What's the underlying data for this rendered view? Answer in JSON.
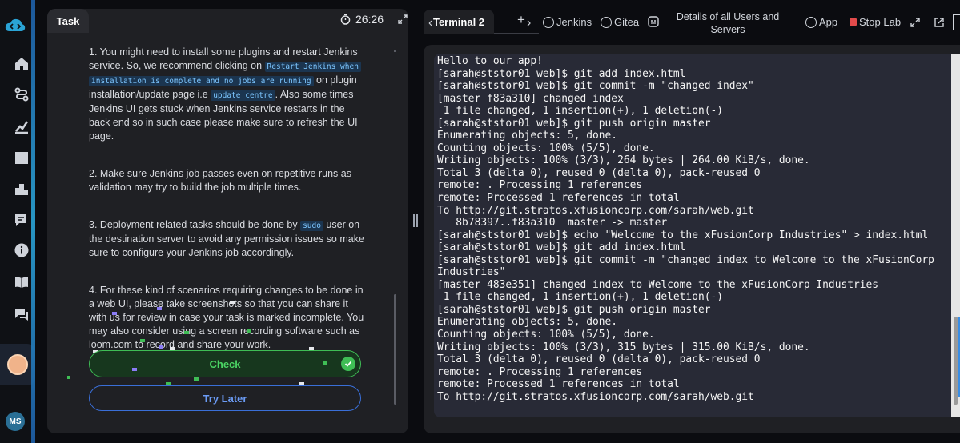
{
  "task": {
    "tab_label": "Task",
    "timer": "26:26",
    "paragraphs": [
      {
        "t1": "1. You might need to install some plugins and restart Jenkins service. So, we recommend clicking on ",
        "c1": "Restart Jenkins when",
        "c1b": "installation is complete and no jobs are running",
        "t2": " on plugin installation/update page i.e ",
        "c2": "update centre",
        "t3": ". Also some times Jenkins UI gets stuck when Jenkins service restarts in the back end so in such case please make sure to refresh the UI page."
      },
      {
        "t1": "2. Make sure Jenkins job passes even on repetitive runs as validation may try to build the job multiple times."
      },
      {
        "t1": "3. Deployment related tasks should be done by ",
        "c1": "sudo",
        "t2": " user on the destination server to avoid any permission issues so make sure to configure your Jenkins job accordingly."
      },
      {
        "t1": "4. For these kind of scenarios requiring changes to be done in a web UI, please take screenshots so that you can share it with us for review in case your task is marked incomplete. You may also consider using a screen recording software such as loom.com to record and share your work."
      }
    ],
    "check_label": "Check",
    "later_label": "Try Later"
  },
  "topbar": {
    "terminal_tab": "Terminal 2",
    "links": {
      "jenkins": "Jenkins",
      "gitea": "Gitea",
      "details": "Details of all Users and Servers",
      "app": "App",
      "stop": "Stop Lab"
    }
  },
  "user": {
    "initials": "MS"
  },
  "terminal": {
    "lines": [
      "Hello to our app!",
      "[sarah@ststor01 web]$ git add index.html",
      "[sarah@ststor01 web]$ git commit -m \"changed index\"",
      "[master f83a310] changed index",
      " 1 file changed, 1 insertion(+), 1 deletion(-)",
      "[sarah@ststor01 web]$ git push origin master",
      "Enumerating objects: 5, done.",
      "Counting objects: 100% (5/5), done.",
      "Writing objects: 100% (3/3), 264 bytes | 264.00 KiB/s, done.",
      "Total 3 (delta 0), reused 0 (delta 0), pack-reused 0",
      "remote: . Processing 1 references",
      "remote: Processed 1 references in total",
      "To http://git.stratos.xfusioncorp.com/sarah/web.git",
      "   8b78397..f83a310  master -> master",
      "[sarah@ststor01 web]$ echo \"Welcome to the xFusionCorp Industries\" > index.html",
      "[sarah@ststor01 web]$ git add index.html",
      "[sarah@ststor01 web]$ git commit -m \"changed index to Welcome to the xFusionCorp",
      "Industries\"",
      "[master 483e351] changed index to Welcome to the xFusionCorp Industries",
      " 1 file changed, 1 insertion(+), 1 deletion(-)",
      "[sarah@ststor01 web]$ git push origin master",
      "Enumerating objects: 5, done.",
      "Counting objects: 100% (5/5), done.",
      "Writing objects: 100% (3/3), 315 bytes | 315.00 KiB/s, done.",
      "Total 3 (delta 0), reused 0 (delta 0), pack-reused 0",
      "remote: . Processing 1 references",
      "remote: Processed 1 references in total",
      "To http://git.stratos.xfusioncorp.com/sarah/web.git"
    ]
  },
  "colors": {
    "accent": "#2aa4d6",
    "check": "#3fbd55",
    "later": "#3a6fd8",
    "stop": "#e24b4b",
    "terminal_bg": "#282a36"
  }
}
